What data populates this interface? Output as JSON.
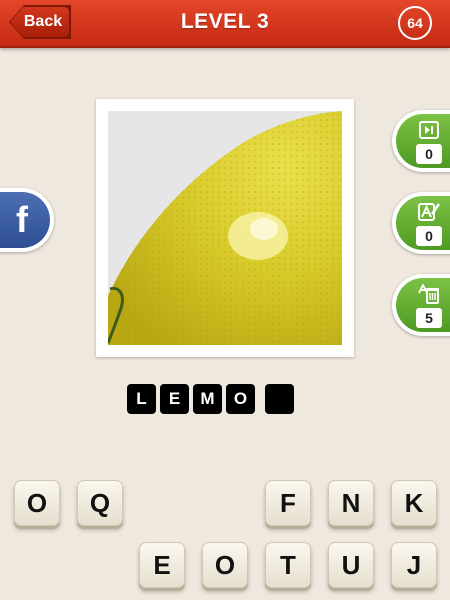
{
  "header": {
    "back_label": "Back",
    "title": "LEVEL 3",
    "coins": "64"
  },
  "social": {
    "facebook_label": "f"
  },
  "hints": [
    {
      "icon": "skip-icon",
      "count": "0"
    },
    {
      "icon": "reveal-letter-icon",
      "count": "0"
    },
    {
      "icon": "remove-letters-icon",
      "count": "5"
    }
  ],
  "answer_slots": [
    "L",
    "E",
    "M",
    "O",
    ""
  ],
  "tiles_row1": [
    "O",
    "Q",
    "",
    "",
    "F",
    "N",
    "K"
  ],
  "tiles_row2": [
    "",
    "E",
    "O",
    "T",
    "U",
    "J"
  ],
  "colors": {
    "header_red": "#d2381d",
    "hint_green": "#62ad30",
    "facebook_blue": "#3b5998",
    "background": "#efe8de"
  }
}
